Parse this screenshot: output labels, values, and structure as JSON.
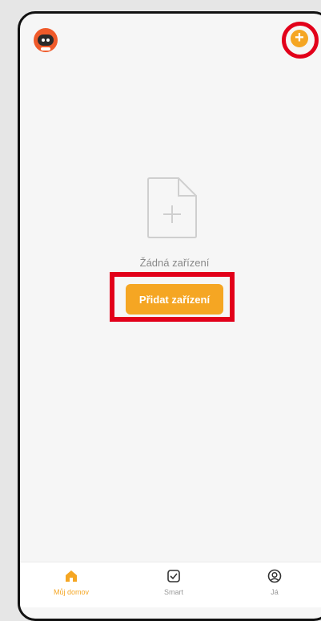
{
  "header": {
    "avatar_icon": "robot-avatar-icon",
    "add_icon": "plus-circle-icon"
  },
  "empty_state": {
    "icon": "add-document-icon",
    "message": "Žádná zařízení",
    "add_button_label": "Přidat zařízení"
  },
  "tabs": [
    {
      "label": "Můj domov",
      "icon": "home-icon",
      "active": true
    },
    {
      "label": "Smart",
      "icon": "checkbox-icon",
      "active": false
    },
    {
      "label": "Já",
      "icon": "user-circle-icon",
      "active": false
    }
  ],
  "colors": {
    "accent": "#f5a623",
    "highlight": "#e2001a",
    "background": "#f6f6f6"
  }
}
